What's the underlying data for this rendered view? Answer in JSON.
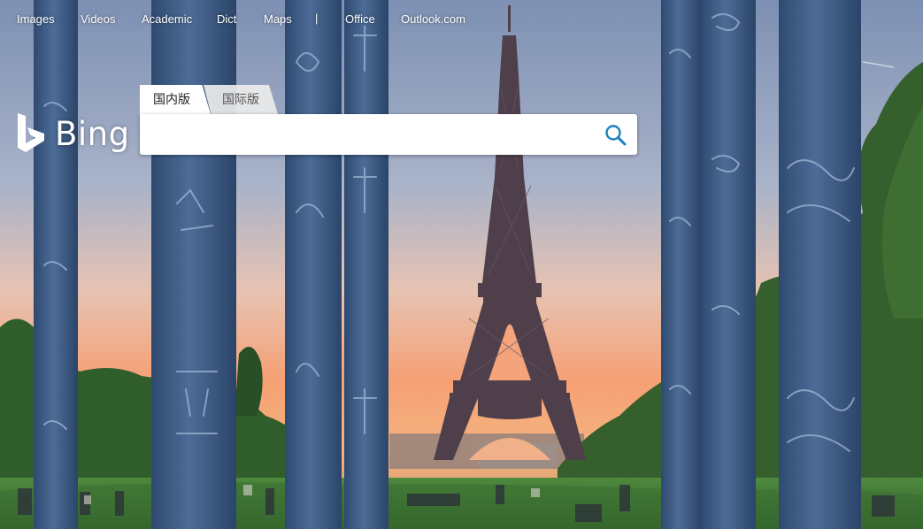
{
  "nav": {
    "items": [
      {
        "label": "Images"
      },
      {
        "label": "Videos"
      },
      {
        "label": "Academic"
      },
      {
        "label": "Dict"
      },
      {
        "label": "Maps"
      },
      {
        "label": "Office"
      },
      {
        "label": "Outlook.com"
      }
    ],
    "separator": "|"
  },
  "logo": {
    "text": "Bing"
  },
  "search": {
    "tabs": [
      {
        "label": "国内版",
        "active": true
      },
      {
        "label": "国际版",
        "active": false
      }
    ],
    "value": "",
    "placeholder": "",
    "button_icon": "search-icon"
  },
  "background": {
    "subject": "eiffel-tower-with-pillars",
    "colors": {
      "sky_top": "#7f93b5",
      "sky_horizon": "#f2a77a",
      "pillar": "#3f5d86",
      "tower": "#4a3c4a",
      "grass": "#3f7a3a",
      "trees": "#2f5e2b"
    }
  },
  "accent_color": "#1a7fbf"
}
